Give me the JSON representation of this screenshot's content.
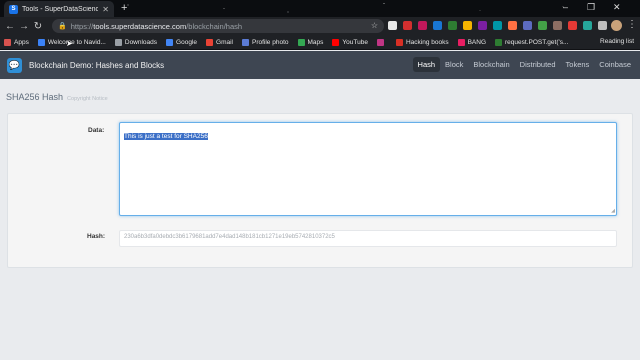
{
  "browser": {
    "tab_title": "Tools - SuperDataScience",
    "tab_favicon_letter": "S",
    "url_proto": "https://",
    "url_host": "tools.superdatascience.com",
    "url_path": "/blockchain/hash",
    "reading_list": "Reading list",
    "bookmarks": [
      {
        "label": "Apps",
        "color": "#d9534f"
      },
      {
        "label": "Welcome to Navid...",
        "color": "#3b82f6"
      },
      {
        "label": "Downloads",
        "color": "#9aa0a6"
      },
      {
        "label": "Google",
        "color": "#4285f4"
      },
      {
        "label": "Gmail",
        "color": "#ea4335"
      },
      {
        "label": "Profile photo",
        "color": "#5b7bd5"
      },
      {
        "label": "Maps",
        "color": "#34a853"
      },
      {
        "label": "YouTube",
        "color": "#ff0000"
      },
      {
        "label": "",
        "color": "#c13584"
      },
      {
        "label": "Hacking books",
        "color": "#d93025"
      },
      {
        "label": "BANG",
        "color": "#e91e63"
      },
      {
        "label": "request.POST.get('s...",
        "color": "#2e7d32"
      }
    ]
  },
  "app": {
    "brand": "Blockchain Demo: Hashes and Blocks",
    "nav": [
      "Hash",
      "Block",
      "Blockchain",
      "Distributed",
      "Tokens",
      "Coinbase"
    ],
    "active_nav": "Hash"
  },
  "page": {
    "title": "SHA256 Hash",
    "copyright": "Copyright Notice",
    "data_label": "Data:",
    "data_value": "This is just a test for SHA256",
    "hash_label": "Hash:",
    "hash_value": "230a6b3dfa0debdc3b6179681add7e4dad148b181cb1271e19eb5742810372c5"
  }
}
